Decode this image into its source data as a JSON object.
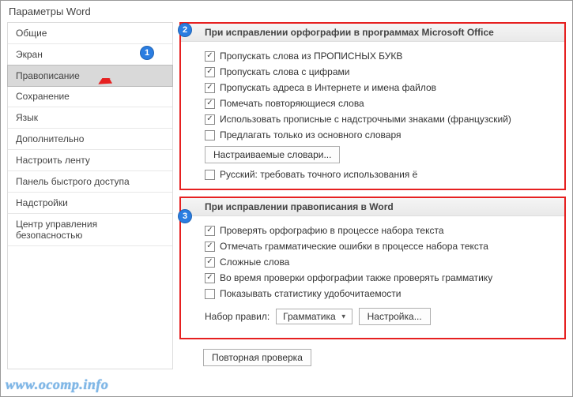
{
  "window": {
    "title": "Параметры Word"
  },
  "sidebar": {
    "items": [
      {
        "label": "Общие"
      },
      {
        "label": "Экран"
      },
      {
        "label": "Правописание"
      },
      {
        "label": "Сохранение"
      },
      {
        "label": "Язык"
      },
      {
        "label": "Дополнительно"
      },
      {
        "label": "Настроить ленту"
      },
      {
        "label": "Панель быстрого доступа"
      },
      {
        "label": "Надстройки"
      },
      {
        "label": "Центр управления безопасностью"
      }
    ],
    "selected_index": 2
  },
  "group1": {
    "title": "При исправлении орфографии в программах Microsoft Office",
    "opt0": "Пропускать слова из ПРОПИСНЫХ БУКВ",
    "opt1": "Пропускать слова с цифрами",
    "opt2": "Пропускать адреса в Интернете и имена файлов",
    "opt3": "Помечать повторяющиеся слова",
    "opt4": "Использовать прописные с надстрочными знаками (французский)",
    "opt5": "Предлагать только из основного словаря",
    "btn_dict": "Настраиваемые словари...",
    "opt6": "Русский: требовать точного использования ё"
  },
  "group2": {
    "title": "При исправлении правописания в Word",
    "opt0": "Проверять орфографию в процессе набора текста",
    "opt1": "Отмечать грамматические ошибки в процессе набора текста",
    "opt2": "Сложные слова",
    "opt3": "Во время проверки орфографии также проверять грамматику",
    "opt4": "Показывать статистику удобочитаемости",
    "rules_label": "Набор правил:",
    "rules_value": "Грамматика",
    "btn_settings": "Настройка..."
  },
  "recheck_btn": "Повторная проверка",
  "badges": {
    "b1": "1",
    "b2": "2",
    "b3": "3"
  },
  "watermark": "www.ocomp.info"
}
